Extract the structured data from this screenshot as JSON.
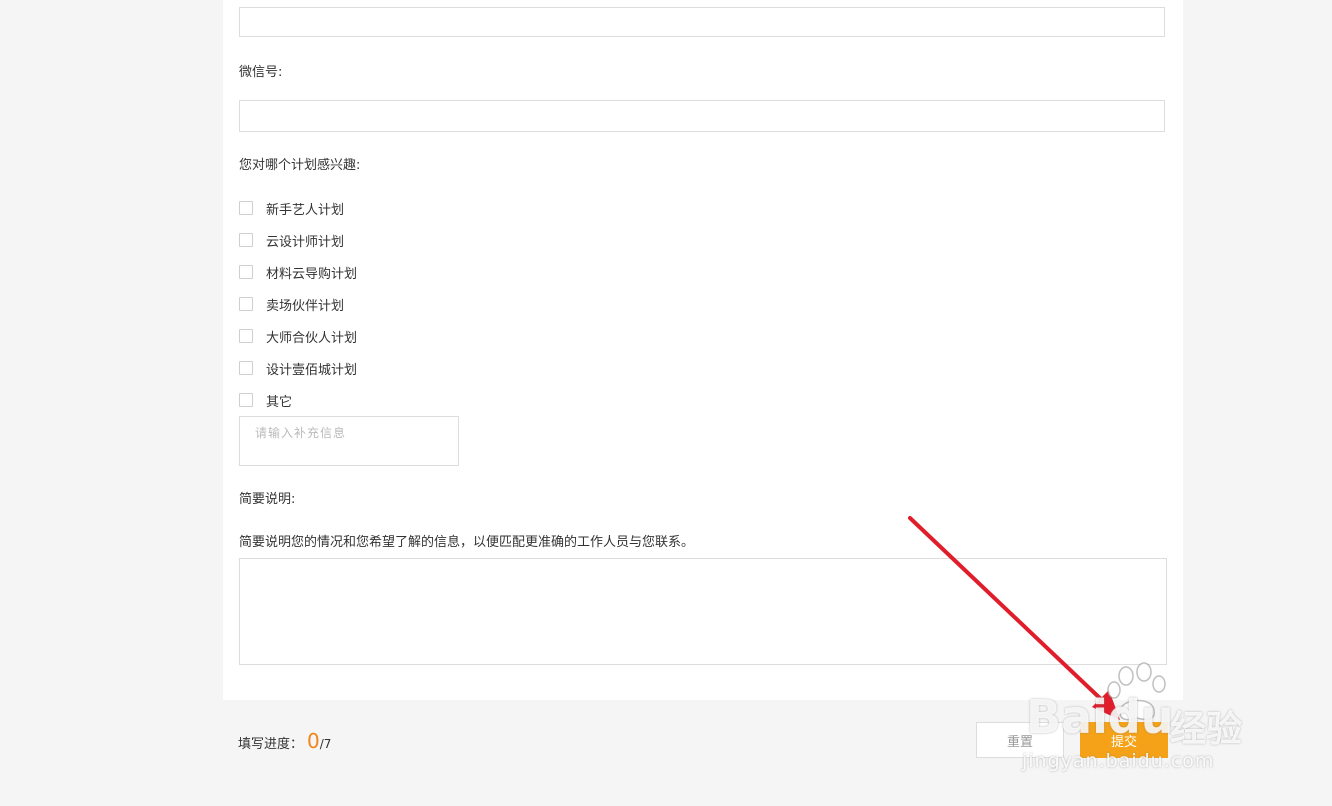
{
  "form": {
    "wechat_label": "微信号:",
    "interest_label": "您对哪个计划感兴趣:",
    "plans": [
      {
        "label": "新手艺人计划",
        "checked": false
      },
      {
        "label": "云设计师计划",
        "checked": false
      },
      {
        "label": "材料云导购计划",
        "checked": false
      },
      {
        "label": "卖场伙伴计划",
        "checked": false
      },
      {
        "label": "大师合伙人计划",
        "checked": false
      },
      {
        "label": "设计壹佰城计划",
        "checked": false
      },
      {
        "label": "其它",
        "checked": false
      }
    ],
    "supplement_placeholder": "请输入补充信息",
    "brief_label": "简要说明:",
    "brief_hint": "简要说明您的情况和您希望了解的信息，以便匹配更准确的工作人员与您联系。"
  },
  "footer": {
    "progress_label": "填写进度：",
    "progress_count": "0",
    "progress_total": "/7",
    "reset_label": "重置",
    "submit_label": "提交"
  },
  "watermark": {
    "brand": "Baidu",
    "product": "经验",
    "url": "jingyan.baidu.com"
  },
  "colors": {
    "accent": "#f08519",
    "submit": "#f5a219",
    "arrow": "#e01e2b"
  }
}
